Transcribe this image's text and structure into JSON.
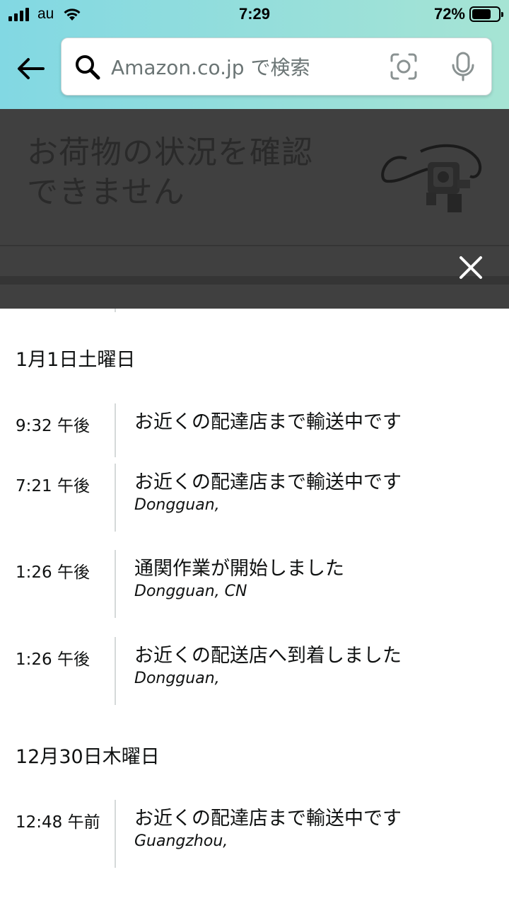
{
  "status_bar": {
    "carrier": "au",
    "time": "7:29",
    "battery": "72%",
    "battery_level": 0.72
  },
  "search": {
    "placeholder": "Amazon.co.jp で検索"
  },
  "overlay": {
    "title_line1": "お荷物の状況を確認",
    "title_line2": "できません"
  },
  "tracking": {
    "groups": [
      {
        "date": "1月1日土曜日",
        "events": [
          {
            "time": "9:32 午後",
            "description": "お近くの配達店まで輸送中です",
            "location": ""
          },
          {
            "time": "7:21 午後",
            "description": "お近くの配達店まで輸送中です",
            "location": "Dongguan,"
          },
          {
            "time": "1:26 午後",
            "description": "通関作業が開始しました",
            "location": "Dongguan, CN"
          },
          {
            "time": "1:26 午後",
            "description": "お近くの配送店へ到着しました",
            "location": "Dongguan,"
          }
        ]
      },
      {
        "date": "12月30日木曜日",
        "events": [
          {
            "time": "12:48 午前",
            "description": "お近くの配達店まで輸送中です",
            "location": "Guangzhou,"
          }
        ]
      }
    ]
  },
  "icons": {
    "back": "arrow-left-icon",
    "search": "search-icon",
    "camera": "camera-scan-icon",
    "mic": "microphone-icon",
    "close": "close-icon"
  }
}
